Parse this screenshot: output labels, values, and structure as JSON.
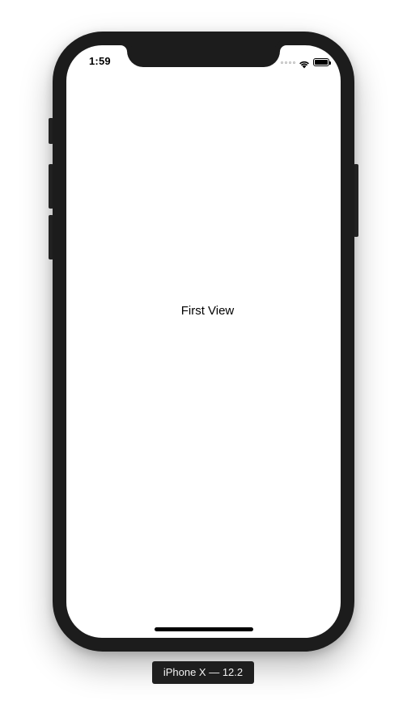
{
  "status_bar": {
    "time": "1:59",
    "icons": [
      "cellular-signal-icon",
      "wifi-icon",
      "battery-icon"
    ]
  },
  "screen": {
    "label": "First View"
  },
  "device_caption": "iPhone X — 12.2",
  "colors": {
    "device_frame": "#1c1c1c",
    "screen_background": "#ffffff",
    "caption_background": "#1e1e1e",
    "caption_text": "#f2f2f2"
  }
}
